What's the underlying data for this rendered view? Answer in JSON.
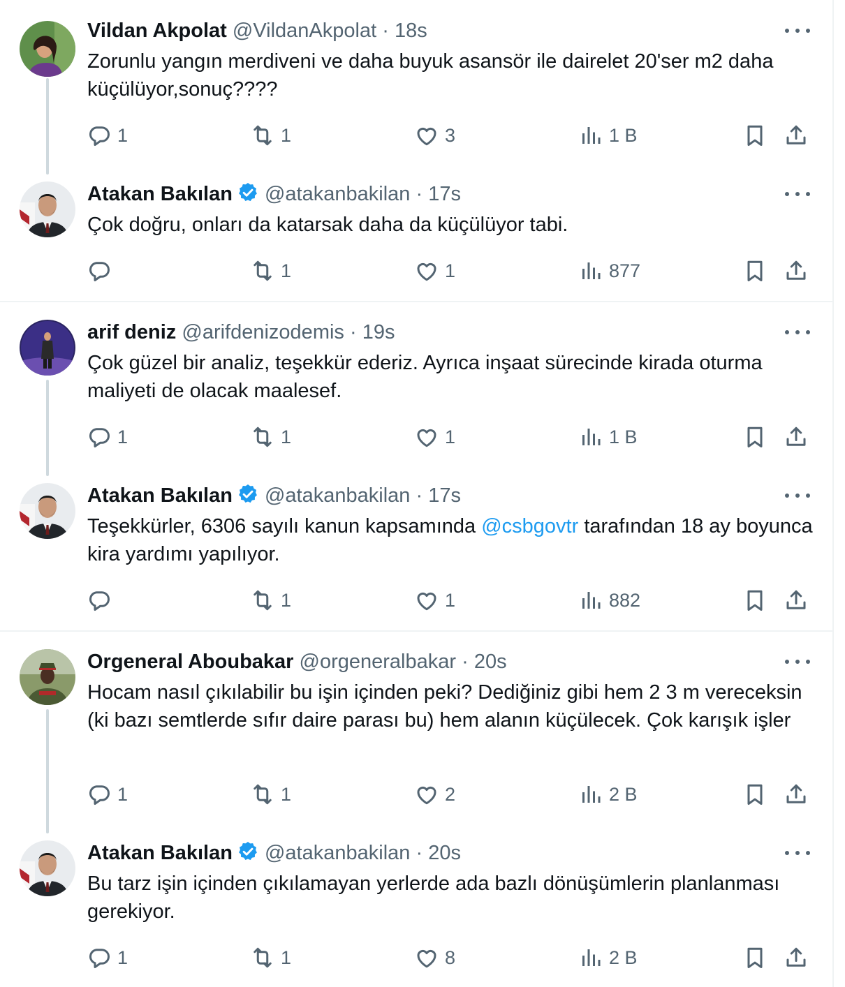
{
  "tweets": [
    {
      "name": "Vildan Akpolat",
      "handle": "@VildanAkpolat",
      "dot": "·",
      "time": "18s",
      "text": "Zorunlu yangın merdiveni ve daha buyuk asansör ile dairelet 20'ser m2 daha küçülüyor,sonuç????",
      "replies": "1",
      "retweets": "1",
      "likes": "3",
      "views": "1 B"
    },
    {
      "name": "Atakan Bakılan",
      "handle": "@atakanbakilan",
      "dot": "·",
      "time": "17s",
      "text": "Çok doğru, onları da katarsak daha da küçülüyor tabi.",
      "replies": "",
      "retweets": "1",
      "likes": "1",
      "views": "877"
    },
    {
      "name": "arif deniz",
      "handle": "@arifdenizodemis",
      "dot": "·",
      "time": "19s",
      "text": "Çok güzel bir analiz, teşekkür ederiz. Ayrıca inşaat sürecinde kirada oturma maliyeti de olacak maalesef.",
      "replies": "1",
      "retweets": "1",
      "likes": "1",
      "views": "1 B"
    },
    {
      "name": "Atakan Bakılan",
      "handle": "@atakanbakilan",
      "dot": "·",
      "time": "17s",
      "text_before": "Teşekkürler, 6306 sayılı kanun kapsamında ",
      "mention": "@csbgovtr",
      "text_after": " tarafından 18 ay boyunca kira yardımı yapılıyor.",
      "replies": "",
      "retweets": "1",
      "likes": "1",
      "views": "882"
    },
    {
      "name": "Orgeneral Aboubakar",
      "handle": "@orgeneralbakar",
      "dot": "·",
      "time": "20s",
      "text": "Hocam nasıl çıkılabilir bu işin içinden peki? Dediğiniz gibi hem 2 3 m vereceksin (ki bazı semtlerde sıfır daire parası bu) hem alanın küçülecek. Çok karışık işler",
      "replies": "1",
      "retweets": "1",
      "likes": "2",
      "views": "2 B"
    },
    {
      "name": "Atakan Bakılan",
      "handle": "@atakanbakilan",
      "dot": "·",
      "time": "20s",
      "text": "Bu tarz işin içinden çıkılamayan yerlerde ada bazlı dönüşümlerin planlanması gerekiyor.",
      "replies": "1",
      "retweets": "1",
      "likes": "8",
      "views": "2 B"
    }
  ],
  "icons": [
    "reply-icon",
    "retweet-icon",
    "like-icon",
    "views-icon",
    "bookmark-icon",
    "share-icon",
    "more-icon",
    "verified-badge-icon"
  ],
  "colors": {
    "text": "#0f1419",
    "secondary": "#536471",
    "link": "#1d9bf0",
    "verified": "#1d9bf0",
    "border": "#eff3f4",
    "thread": "#cfd9de"
  }
}
